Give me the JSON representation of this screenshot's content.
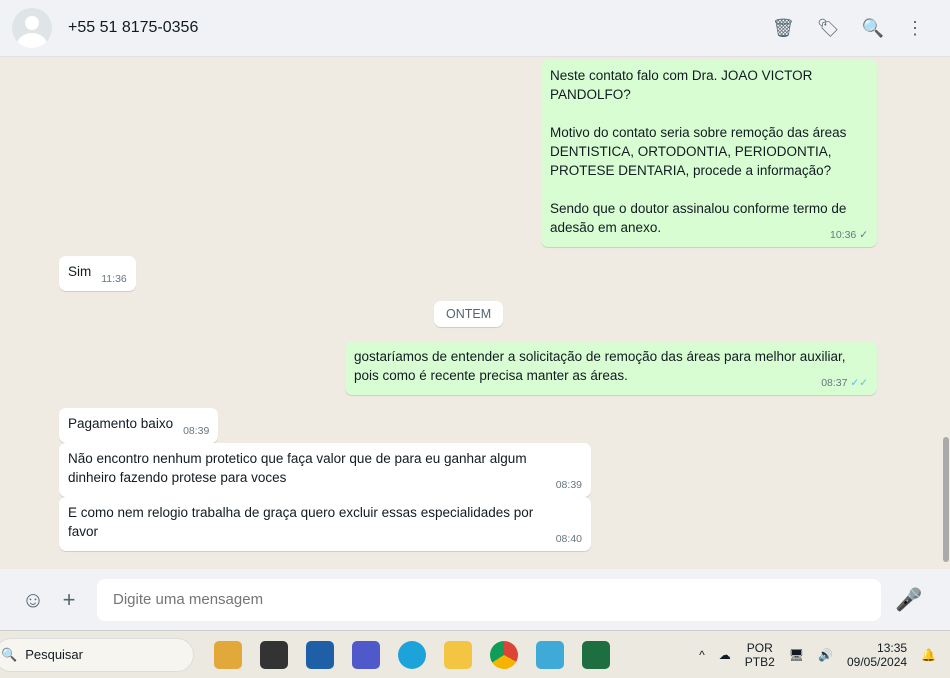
{
  "header": {
    "contact": "+55 51 8175-0356"
  },
  "messages": [
    {
      "dir": "out",
      "text": "Neste contato falo com Dra. JOAO VICTOR\nPANDOLFO?\n\nMotivo do contato seria sobre remoção das áreas\nDENTISTICA, ORTODONTIA, PERIODONTIA,\nPROTESE DENTARIA, procede a informação?\n\nSendo que o doutor assinalou conforme termo de\nadesão em anexo.",
      "time": "10:36",
      "status": "✓"
    },
    {
      "dir": "in",
      "text": "Sim",
      "time": "11:36"
    },
    {
      "dir": "out",
      "text": "gostaríamos de entender a solicitação de remoção das áreas para melhor auxiliar,\npois como é recente precisa manter as áreas.",
      "time": "08:37",
      "status": "✓✓"
    },
    {
      "dir": "in",
      "text": "Pagamento baixo",
      "time": "08:39"
    },
    {
      "dir": "in",
      "text": "Não encontro nenhum protetico que faça valor que de para eu ganhar algum\ndinheiro fazendo protese para voces",
      "time": "08:39"
    },
    {
      "dir": "in",
      "text": "E como nem relogio trabalha de graça quero excluir essas especialidades por\nfavor",
      "time": "08:40"
    }
  ],
  "date_divider": "ONTEM",
  "composer": {
    "placeholder": "Digite uma mensagem"
  },
  "taskbar": {
    "search": "Pesquisar",
    "lang1": "POR",
    "lang2": "PTB2",
    "time": "13:35",
    "date": "09/05/2024"
  }
}
